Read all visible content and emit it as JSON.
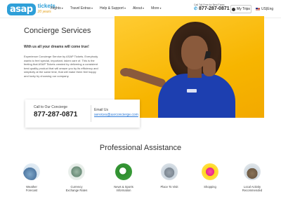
{
  "header": {
    "logo": {
      "brand": "asap",
      "product": "tickets",
      "tagline": "20 years"
    },
    "nav": [
      {
        "label": "Flights",
        "caret": "▾"
      },
      {
        "label": "Travel Extras",
        "caret": "▾"
      },
      {
        "label": "Help & Support",
        "caret": "▾"
      },
      {
        "label": "About",
        "caret": "▾"
      },
      {
        "label": "More",
        "caret": "▾"
      }
    ],
    "call_label": "Call Toll-Free for Best Fares",
    "call_number": "877-287-0871",
    "my_trips_label": "My Trips",
    "locale_label": "US|Eng"
  },
  "hero": {
    "title": "Concierge Services",
    "subtitle": "With us all your dreams will come true!",
    "body": "Experience Concierge Service by ASAP Tickets. Everybody wants to feel special, important, taken care of. This is the feeling that ASAP Tickets created by delivering a consistent best quality product that will amaze you by its efficiency and simplicity at the same time, that will make them feel happy and lucky by choosing our company.",
    "contact": {
      "call_label": "Call to Our Concierge",
      "call_number": "877-287-0871",
      "email_label": "Email Us",
      "email": "services@asrconcierge.com"
    }
  },
  "assistance": {
    "title": "Professional Assistance",
    "services": [
      {
        "label": "Weather\nForecast",
        "icon": "weather-image"
      },
      {
        "label": "Currency\nExchange Rates",
        "icon": "currency-image"
      },
      {
        "label": "News & Sports\nInformation",
        "icon": "news-image"
      },
      {
        "label": "Place To Visit",
        "icon": "places-image"
      },
      {
        "label": "Shopping",
        "icon": "shopping-image"
      },
      {
        "label": "Local Activity\nRecommended",
        "icon": "activity-image"
      }
    ]
  },
  "colors": {
    "brand_blue": "#2e9fd8",
    "hero_yellow": "#f7b500",
    "link_blue": "#2e7bd8"
  }
}
